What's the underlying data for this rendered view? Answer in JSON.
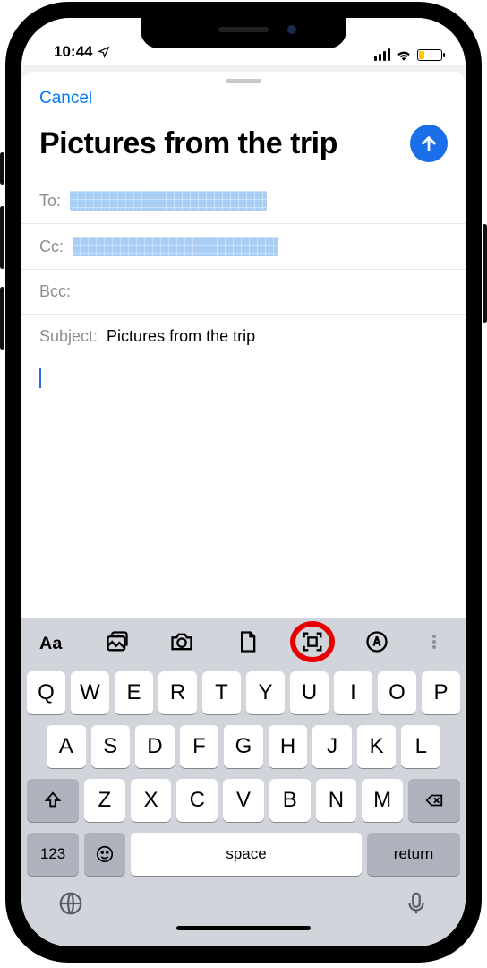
{
  "status": {
    "time": "10:44"
  },
  "nav": {
    "cancel": "Cancel"
  },
  "compose": {
    "title": "Pictures from the trip",
    "to_label": "To:",
    "cc_label": "Cc:",
    "bcc_label": "Bcc:",
    "subject_label": "Subject:",
    "subject_value": "Pictures from the trip"
  },
  "keyboard": {
    "row1": [
      "Q",
      "W",
      "E",
      "R",
      "T",
      "Y",
      "U",
      "I",
      "O",
      "P"
    ],
    "row2": [
      "A",
      "S",
      "D",
      "F",
      "G",
      "H",
      "J",
      "K",
      "L"
    ],
    "row3": [
      "Z",
      "X",
      "C",
      "V",
      "B",
      "N",
      "M"
    ],
    "numbers": "123",
    "space": "space",
    "return": "return"
  }
}
